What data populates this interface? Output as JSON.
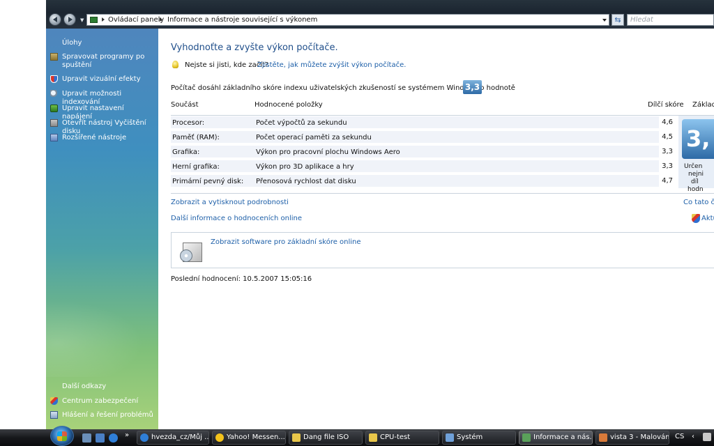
{
  "window": {
    "breadcrumbs": [
      "Ovládací panely",
      "Informace a nástroje související s výkonem"
    ],
    "search_placeholder": "Hledat"
  },
  "sidebar": {
    "tasks_heading": "Úlohy",
    "tasks": [
      {
        "label": "Spravovat programy po spuštění",
        "icon": "startup-programs-icon"
      },
      {
        "label": "Upravit vizuální efekty",
        "icon": "shield-icon"
      },
      {
        "label": "Upravit možnosti indexování",
        "icon": "search-icon"
      },
      {
        "label": "Upravit nastavení napájení",
        "icon": "power-icon"
      },
      {
        "label": "Otevřít nástroj Vyčištění disku",
        "icon": "disk-cleanup-icon"
      },
      {
        "label": "Rozšířené nástroje",
        "icon": "tools-icon"
      }
    ],
    "links_heading": "Další odkazy",
    "links": [
      {
        "label": "Centrum zabezpečení",
        "icon": "security-center-icon"
      },
      {
        "label": "Hlášení a řešení problémů",
        "icon": "problem-reports-icon"
      }
    ]
  },
  "main": {
    "title": "Vyhodnoťte a zvyšte výkon počítače.",
    "unsure": "Nejste si jisti, kde začít?",
    "learn_link": "Zjistěte, jak můžete zvýšit výkon počítače.",
    "score_text": "Počítač dosáhl základního skóre indexu uživatelských zkušeností se systémem Windows o hodnotě",
    "score_value": "3,3",
    "table": {
      "headers": [
        "Součást",
        "Hodnocené položky",
        "Dílčí skóre",
        "Základ"
      ],
      "rows": [
        {
          "component": "Procesor:",
          "item": "Počet výpočtů za sekundu",
          "score": "4,6"
        },
        {
          "component": "Paměť (RAM):",
          "item": "Počet operací paměti za sekundu",
          "score": "4,5"
        },
        {
          "component": "Grafika:",
          "item": "Výkon pro pracovní plochu Windows Aero",
          "score": "3,3"
        },
        {
          "component": "Herní grafika:",
          "item": "Výkon pro 3D aplikace a hry",
          "score": "3,3"
        },
        {
          "component": "Primární pevný disk:",
          "item": "Přenosová rychlost dat disku",
          "score": "4,7"
        }
      ],
      "base_badge": "3,",
      "base_text_lines": [
        "Určen",
        "nejni",
        "díl",
        "hodn"
      ]
    },
    "links": {
      "view_print": "Zobrazit a vytisknout podrobnosti",
      "more_info": "Další informace o hodnoceních online",
      "what_is": "Co tato čís",
      "update": "Aktu"
    },
    "software_link": "Zobrazit software pro základní skóre online",
    "last_eval": "Poslední hodnocení: 10.5.2007 15:05:16"
  },
  "taskbar": {
    "buttons": [
      {
        "label": "hvezda_cz/Můj ...",
        "icon": "ie-icon",
        "color": "#2f7fd8"
      },
      {
        "label": "Yahoo! Messen...",
        "icon": "yahoo-messenger-icon",
        "color": "#f2c21b"
      },
      {
        "label": "Dang file ISO",
        "icon": "folder-icon",
        "color": "#e8c64a"
      },
      {
        "label": "CPU-test",
        "icon": "folder-icon",
        "color": "#e8c64a"
      },
      {
        "label": "Systém",
        "icon": "system-icon",
        "color": "#6fa0d8"
      },
      {
        "label": "Informace a nás...",
        "icon": "control-panel-icon",
        "color": "#5aa05a"
      },
      {
        "label": "vista 3 - Malování",
        "icon": "paint-icon",
        "color": "#d87a3a"
      }
    ],
    "language": "CS"
  }
}
